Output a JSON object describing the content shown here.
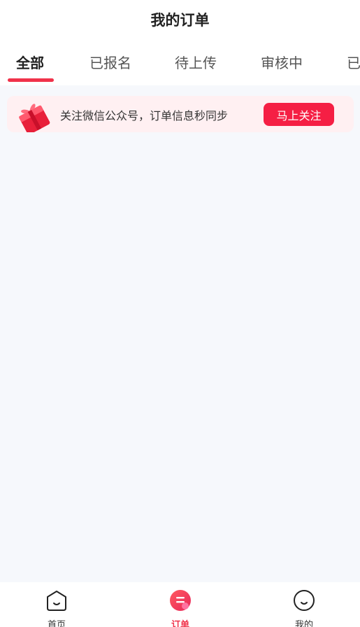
{
  "header": {
    "title": "我的订单"
  },
  "tabs": [
    {
      "label": "全部",
      "active": true
    },
    {
      "label": "已报名"
    },
    {
      "label": "待上传"
    },
    {
      "label": "审核中"
    },
    {
      "label": "已"
    }
  ],
  "banner": {
    "text": "关注微信公众号，订单信息秒同步",
    "button_label": "马上关注",
    "icon": "gift-icon"
  },
  "tabbar": {
    "items": [
      {
        "label": "首页",
        "icon": "home-face-icon"
      },
      {
        "label": "订单",
        "icon": "order-list-icon",
        "active": true
      },
      {
        "label": "我的",
        "icon": "profile-face-icon"
      }
    ]
  },
  "colors": {
    "accent": "#f0324a",
    "button": "#f51f44",
    "banner_bg": "#fff0f2",
    "page_bg": "#f6f8fc"
  }
}
